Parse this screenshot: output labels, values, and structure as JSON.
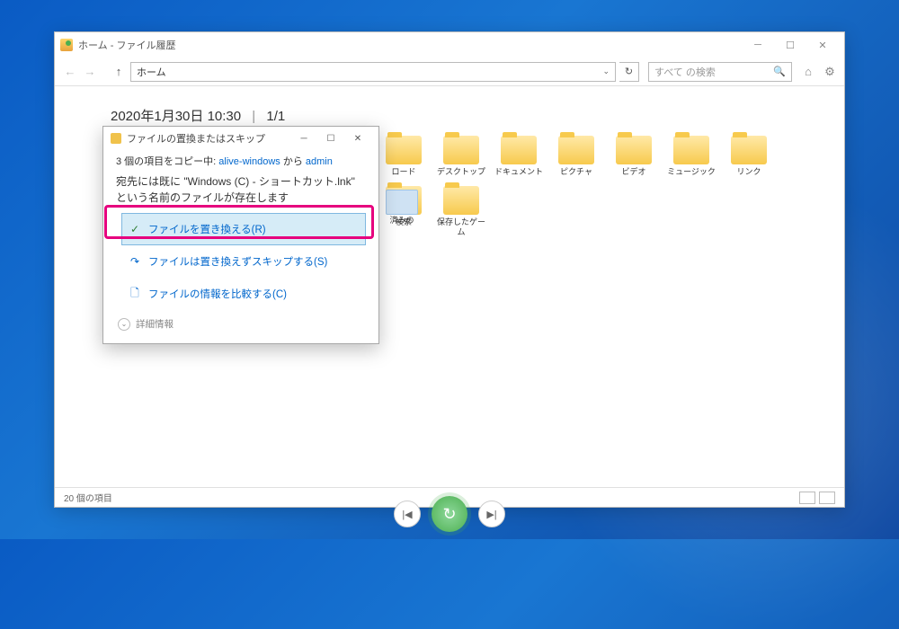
{
  "window": {
    "title": "ホーム - ファイル履歴",
    "address": "ホーム",
    "search_placeholder": "すべて の検索",
    "timestamp": "2020年1月30日 10:30",
    "pager": "1/1",
    "status": "20 個の項目"
  },
  "folders": [
    {
      "label": "ロード"
    },
    {
      "label": "デスクトップ"
    },
    {
      "label": "ドキュメント"
    },
    {
      "label": "ピクチャ"
    },
    {
      "label": "ビデオ"
    },
    {
      "label": "ミュージック"
    },
    {
      "label": "リンク"
    },
    {
      "label": "検索"
    },
    {
      "label": "保存したゲーム"
    }
  ],
  "partial_folder_label": "済みの",
  "dialog": {
    "title": "ファイルの置換またはスキップ",
    "copy_prefix": "3 個の項目をコピー中: ",
    "src": "alive-windows",
    "mid": " から ",
    "dst": "admin",
    "message": "宛先には既に \"Windows (C) - ショートカット.lnk\" という名前のファイルが存在します",
    "option_replace": "ファイルを置き換える(R)",
    "option_skip": "ファイルは置き換えずスキップする(S)",
    "option_compare": "ファイルの情報を比較する(C)",
    "more": "詳細情報"
  }
}
